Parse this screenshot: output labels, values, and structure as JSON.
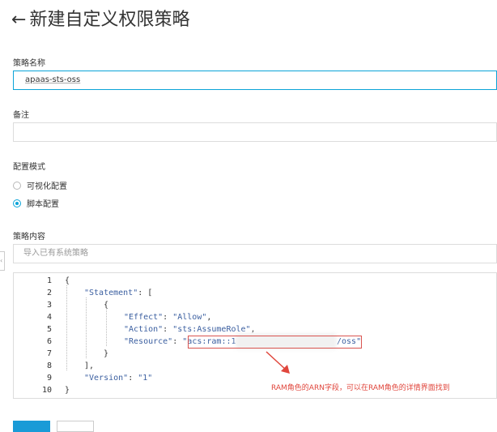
{
  "header": {
    "back_icon": "arrow-left-icon",
    "title": "新建自定义权限策略"
  },
  "form": {
    "policy_name_label": "策略名称",
    "policy_name_value": "apaas-sts-oss",
    "remark_label": "备注",
    "remark_value": "",
    "config_mode_label": "配置模式",
    "mode_options": [
      {
        "label": "可视化配置",
        "selected": false
      },
      {
        "label": "脚本配置",
        "selected": true
      }
    ],
    "policy_content_label": "策略内容",
    "import_placeholder": "导入已有系统策略"
  },
  "editor": {
    "line_numbers": [
      "1",
      "2",
      "3",
      "4",
      "5",
      "6",
      "7",
      "8",
      "9",
      "10"
    ],
    "lines": {
      "l1": "{",
      "l2_key": "\"Statement\"",
      "l2_rest": ": [",
      "l3": "{",
      "l4_key": "\"Effect\"",
      "l4_sep": ": ",
      "l4_val": "\"Allow\"",
      "l4_end": ",",
      "l5_key": "\"Action\"",
      "l5_sep": ": ",
      "l5_val": "\"sts:AssumeRole\"",
      "l5_end": ",",
      "l6_key": "\"Resource\"",
      "l6_sep": ": ",
      "l6_q": "\"",
      "l6_val_start": "acs:ram::1",
      "l6_val_end": "/oss\"",
      "l7": "}",
      "l8": "],",
      "l9_key": "\"Version\"",
      "l9_sep": ": ",
      "l9_val": "\"1\"",
      "l10": "}"
    }
  },
  "annotation": {
    "text": "RAM角色的ARN字段，可以在RAM角色的详情界面找到",
    "color": "#e0463c"
  },
  "colors": {
    "accent": "#0aa4d8",
    "primary_button": "#1a9bd7"
  }
}
